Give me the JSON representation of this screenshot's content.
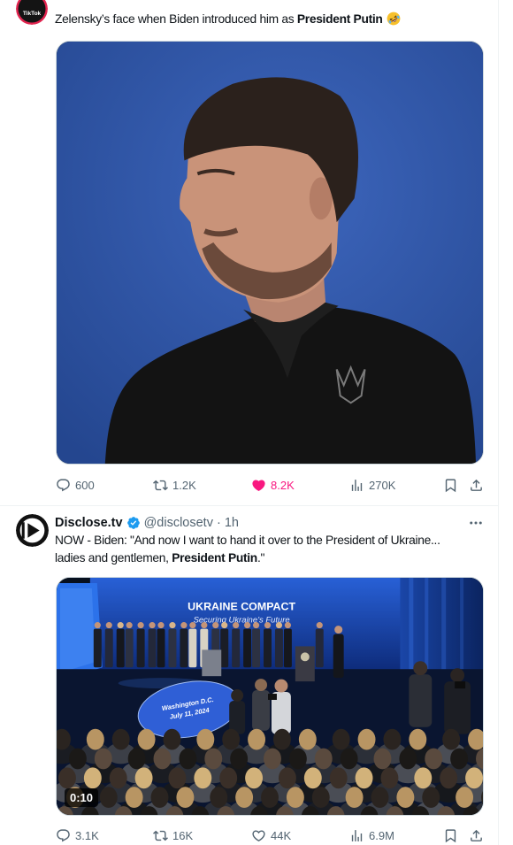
{
  "tweets": [
    {
      "avatar": {
        "logo_text": "TikTok"
      },
      "text_before": "Zelensky’s face when Biden introduced him as ",
      "text_bold": "President Putin",
      "emoji_icon": "rolling-on-floor-laughing-emoji",
      "actions": {
        "replies": "600",
        "reposts": "1.2K",
        "likes": "8.2K",
        "liked": true,
        "views": "270K"
      }
    },
    {
      "author": {
        "name": "Disclose.tv",
        "handle": "@disclosetv",
        "separator": "·",
        "time": "1h",
        "verified": true,
        "avatar_icon": "disclose-tv-play-logo"
      },
      "text_line1": "NOW - Biden: \"And now I want to hand it over to the President of Ukraine...",
      "text_line2_before": "ladies and gentlemen, ",
      "text_bold": "President Putin",
      "text_after": ".\"",
      "video": {
        "duration": "0:10",
        "backdrop_title": "UKRAINE COMPACT",
        "backdrop_subtitle": "Securing Ukraine’s Future",
        "sign_line1": "Washington D.C.",
        "sign_line2": "July 11, 2024"
      },
      "actions": {
        "replies": "3.1K",
        "reposts": "16K",
        "likes": "44K",
        "liked": false,
        "views": "6.9M"
      }
    }
  ],
  "colors": {
    "text": "#0f1419",
    "muted": "#536471",
    "accent": "#1d9bf0",
    "like": "#f91880",
    "border": "#eff3f4"
  }
}
